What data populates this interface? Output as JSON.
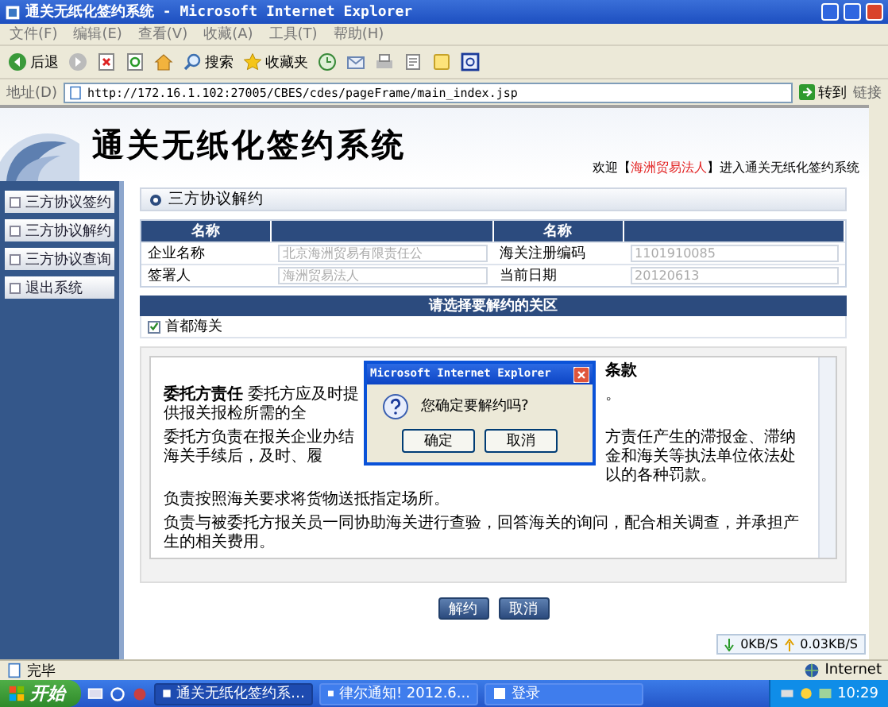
{
  "window": {
    "title": "通关无纸化签约系统 - Microsoft Internet Explorer"
  },
  "menu": [
    "文件(F)",
    "编辑(E)",
    "查看(V)",
    "收藏(A)",
    "工具(T)",
    "帮助(H)"
  ],
  "toolbar": [
    {
      "kind": "back",
      "label": "后退"
    },
    {
      "kind": "forward"
    },
    {
      "kind": "stop"
    },
    {
      "kind": "refresh"
    },
    {
      "kind": "home"
    },
    {
      "kind": "search",
      "label": "搜索"
    },
    {
      "kind": "favorites",
      "label": "收藏夹"
    },
    {
      "kind": "history"
    },
    {
      "kind": "mail"
    },
    {
      "kind": "print"
    },
    {
      "kind": "edit"
    },
    {
      "kind": "folder"
    },
    {
      "kind": "messenger"
    }
  ],
  "address": {
    "label": "地址(D)",
    "url": "http://172.16.1.102:27005/CBES/cdes/pageFrame/main_index.jsp",
    "go": "转到",
    "links": "链接"
  },
  "header": {
    "title": "通关无纸化签约系统",
    "welcome_prefix": "欢迎【",
    "user": "海洲贸易法人",
    "welcome_suffix": "】进入通关无纸化签约系统"
  },
  "sidebar": [
    "三方协议签约",
    "三方协议解约",
    "三方协议查询",
    "退出系统"
  ],
  "panel": {
    "title": "三方协议解约",
    "columns": [
      "名称",
      "名称"
    ],
    "rows": [
      [
        {
          "label": "企业名称",
          "value": "北京海洲贸易有限责任公",
          "disabled": true
        },
        {
          "label": "海关注册编码",
          "value": "1101910085",
          "disabled": true
        }
      ],
      [
        {
          "label": "签署人",
          "value": "海洲贸易法人",
          "disabled": true
        },
        {
          "label": "当前日期",
          "value": "20120613",
          "disabled": true
        }
      ]
    ]
  },
  "customs": {
    "title": "请选择要解约的关区",
    "items": [
      {
        "label": "首都海关",
        "checked": true
      }
    ]
  },
  "terms": {
    "rows": [
      {
        "left": "",
        "right": "条款",
        "kind": "title"
      },
      {
        "left": "**委托方责任** 委托方应及时提供报关报检所需的全",
        "right": "。",
        "kind": "line"
      },
      {
        "left": "委托方负责在报关企业办结海关手续后，及时、履",
        "right": "方责任产生的滞报金、滞纳金和海关等执法单位依法处以的各种罚款。",
        "kind": "line"
      }
    ],
    "paragraphs": [
      "负责按照海关要求将货物送抵指定场所。",
      "负责与被委托方报关员一同协助海关进行查验，回答海关的询问，配合相关调查，并承担产生的相关费用。"
    ]
  },
  "dialog": {
    "title": "Microsoft Internet Explorer",
    "message": "您确定要解约吗?",
    "buttons": [
      "确定",
      "取消"
    ]
  },
  "actions": [
    "解约",
    "取消"
  ],
  "speed": {
    "down": "0KB/S",
    "up": "0.03KB/S"
  },
  "status_bar": {
    "text": "完毕",
    "zone": "Internet"
  },
  "taskbar": {
    "start": "开始",
    "tasks": [
      {
        "label": "通关无纸化签约系…",
        "selected": true
      },
      {
        "label": "律尔通知! 2012.6...",
        "selected": false
      },
      {
        "label": "登录",
        "selected": false
      }
    ],
    "clock": "10:29"
  }
}
